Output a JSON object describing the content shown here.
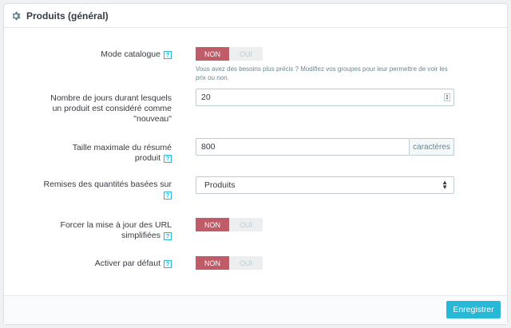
{
  "panel": {
    "title": "Produits (général)",
    "icon": "gear-icon"
  },
  "help_glyph": "?",
  "catalog_mode": {
    "label": "Mode catalogue",
    "no": "NON",
    "yes": "OUI",
    "hint": "Vous avez des besoins plus précis ? Modifiez vos groupes pour leur permettre de voir les prix ou non."
  },
  "new_days": {
    "label_line1": "Nombre de jours durant lesquels",
    "label_line2": "un produit est considéré comme",
    "label_line3": "\"nouveau\"",
    "value": "20"
  },
  "summary_max": {
    "label_line1": "Taille maximale du résumé",
    "label_line2": "produit",
    "value": "800",
    "addon": "caractères"
  },
  "qty_discounts": {
    "label": "Remises des quantités basées sur",
    "selected": "Produits"
  },
  "force_url": {
    "label_line1": "Forcer la mise à jour des URL",
    "label_line2": "simplifiées",
    "no": "NON",
    "yes": "OUI"
  },
  "default_active": {
    "label": "Activer par défaut",
    "no": "NON",
    "yes": "OUI"
  },
  "footer": {
    "save_label": "Enregistrer"
  },
  "colors": {
    "accent": "#25b9d7",
    "switch_on": "#c05c67"
  }
}
